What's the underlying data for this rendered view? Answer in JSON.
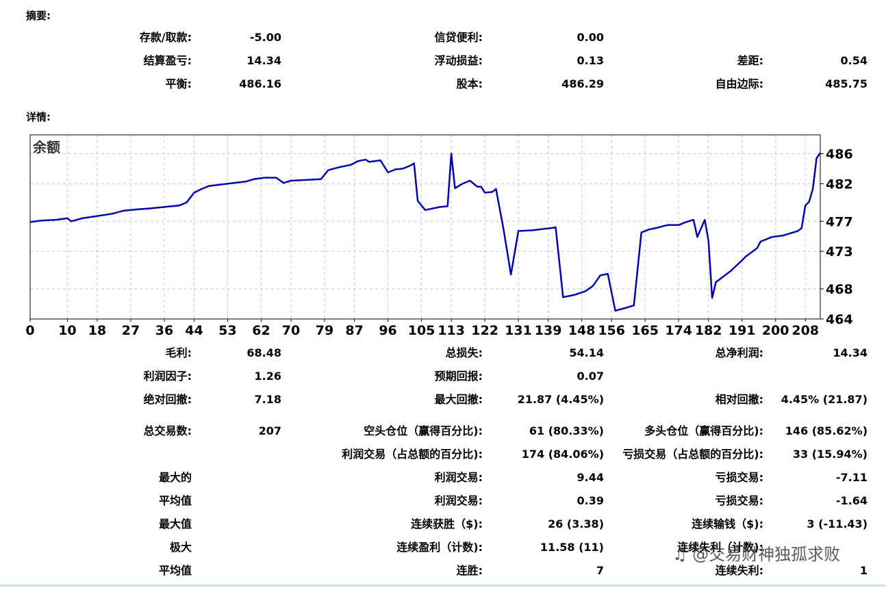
{
  "summary": {
    "title": "摘要:",
    "rows": [
      [
        {
          "label": "存款/取款:",
          "value": "-5.00"
        },
        {
          "label": "信贷便利:",
          "value": "0.00"
        },
        null
      ],
      [
        {
          "label": "结算盈亏:",
          "value": "14.34"
        },
        {
          "label": "浮动损益:",
          "value": "0.13"
        },
        {
          "label": "差距:",
          "value": "0.54"
        }
      ],
      [
        {
          "label": "平衡:",
          "value": "486.16"
        },
        {
          "label": "股本:",
          "value": "486.29"
        },
        {
          "label": "自由边际:",
          "value": "485.75"
        }
      ]
    ]
  },
  "details": {
    "title": "详情:"
  },
  "chart_data": {
    "type": "line",
    "title": "余额",
    "series": [
      {
        "name": "余额",
        "color": "#0000b4",
        "points": [
          [
            0,
            476.9
          ],
          [
            3,
            477.1
          ],
          [
            7,
            477.2
          ],
          [
            10,
            477.4
          ],
          [
            11,
            477.0
          ],
          [
            14,
            477.4
          ],
          [
            18,
            477.7
          ],
          [
            22,
            478.0
          ],
          [
            25,
            478.4
          ],
          [
            29,
            478.6
          ],
          [
            32,
            478.7
          ],
          [
            36,
            478.9
          ],
          [
            40,
            479.1
          ],
          [
            42,
            479.5
          ],
          [
            44,
            480.8
          ],
          [
            46,
            481.3
          ],
          [
            48,
            481.7
          ],
          [
            53,
            482.0
          ],
          [
            58,
            482.3
          ],
          [
            60,
            482.6
          ],
          [
            63,
            482.8
          ],
          [
            66,
            482.8
          ],
          [
            68,
            482.1
          ],
          [
            70,
            482.4
          ],
          [
            74,
            482.5
          ],
          [
            78,
            482.6
          ],
          [
            80,
            483.8
          ],
          [
            83,
            484.2
          ],
          [
            86,
            484.5
          ],
          [
            88,
            485.0
          ],
          [
            90,
            485.2
          ],
          [
            91,
            484.9
          ],
          [
            94,
            485.1
          ],
          [
            96,
            483.5
          ],
          [
            98,
            483.9
          ],
          [
            100,
            484.0
          ],
          [
            102,
            484.4
          ],
          [
            103,
            484.7
          ],
          [
            104,
            479.7
          ],
          [
            106,
            478.5
          ],
          [
            110,
            478.9
          ],
          [
            112,
            479.0
          ],
          [
            113,
            486.0
          ],
          [
            114,
            481.4
          ],
          [
            116,
            482.0
          ],
          [
            118,
            482.4
          ],
          [
            120,
            481.6
          ],
          [
            121,
            481.6
          ],
          [
            122,
            480.8
          ],
          [
            124,
            480.9
          ],
          [
            125,
            481.3
          ],
          [
            127,
            476.0
          ],
          [
            129,
            469.9
          ],
          [
            131,
            475.7
          ],
          [
            135,
            475.8
          ],
          [
            138,
            476.0
          ],
          [
            140,
            476.1
          ],
          [
            141,
            476.2
          ],
          [
            143,
            466.9
          ],
          [
            146,
            467.2
          ],
          [
            149,
            467.7
          ],
          [
            151,
            468.4
          ],
          [
            153,
            469.8
          ],
          [
            155,
            470.0
          ],
          [
            157,
            465.1
          ],
          [
            160,
            465.5
          ],
          [
            162,
            465.8
          ],
          [
            164,
            475.5
          ],
          [
            166,
            475.9
          ],
          [
            168,
            476.1
          ],
          [
            171,
            476.5
          ],
          [
            174,
            476.5
          ],
          [
            176,
            476.9
          ],
          [
            178,
            477.2
          ],
          [
            179,
            474.9
          ],
          [
            181,
            477.2
          ],
          [
            182,
            474.4
          ],
          [
            183,
            466.8
          ],
          [
            184,
            468.9
          ],
          [
            188,
            470.4
          ],
          [
            191,
            471.8
          ],
          [
            192,
            472.3
          ],
          [
            195,
            473.4
          ],
          [
            196,
            474.3
          ],
          [
            199,
            474.9
          ],
          [
            202,
            475.1
          ],
          [
            206,
            475.7
          ],
          [
            207,
            476.1
          ],
          [
            208,
            479.1
          ],
          [
            209,
            479.6
          ],
          [
            210,
            481.3
          ],
          [
            211,
            485.4
          ],
          [
            212,
            486.1
          ]
        ]
      }
    ],
    "x_ticks": [
      0,
      10,
      18,
      27,
      36,
      44,
      53,
      62,
      70,
      79,
      87,
      96,
      105,
      113,
      122,
      131,
      139,
      148,
      156,
      165,
      174,
      182,
      191,
      200,
      208
    ],
    "y_ticks": [
      464,
      468,
      473,
      477,
      482,
      486
    ],
    "xlim": [
      0,
      212
    ],
    "ylim": [
      464,
      488.5
    ],
    "grid": true,
    "legend": "none"
  },
  "stats": {
    "rows": [
      [
        {
          "label": "毛利:",
          "value": "68.48"
        },
        {
          "label": "总损失:",
          "value": "54.14"
        },
        {
          "label": "总净利润:",
          "value": "14.34"
        }
      ],
      [
        {
          "label": "利润因子:",
          "value": "1.26"
        },
        {
          "label": "预期回报:",
          "value": "0.07"
        },
        null
      ],
      [
        {
          "label": "绝对回撤:",
          "value": "7.18"
        },
        {
          "label": "最大回撤:",
          "value": "21.87 (4.45%)"
        },
        {
          "label": "相对回撤:",
          "value": "4.45% (21.87)"
        }
      ],
      [
        {
          "label": "总交易数:",
          "value": "207"
        },
        {
          "label": "空头仓位（赢得百分比):",
          "value": "61 (80.33%)"
        },
        {
          "label": "多头仓位（赢得百分比):",
          "value": "146 (85.62%)"
        }
      ],
      [
        null,
        {
          "label": "利润交易（占总额的百分比):",
          "value": "174 (84.06%)"
        },
        {
          "label": "亏损交易（占总额的百分比):",
          "value": "33 (15.94%)"
        }
      ],
      [
        {
          "label": "最大的",
          "value": ""
        },
        {
          "label": "利润交易:",
          "value": "9.44"
        },
        {
          "label": "亏损交易:",
          "value": "-7.11"
        }
      ],
      [
        {
          "label": "平均值",
          "value": ""
        },
        {
          "label": "利润交易:",
          "value": "0.39"
        },
        {
          "label": "亏损交易:",
          "value": "-1.64"
        }
      ],
      [
        {
          "label": "最大值",
          "value": ""
        },
        {
          "label": "连续获胜（$):",
          "value": "26 (3.38)"
        },
        {
          "label": "连续输钱（$):",
          "value": "3 (-11.43)"
        }
      ],
      [
        {
          "label": "极大",
          "value": ""
        },
        {
          "label": "连续盈利（计数):",
          "value": "11.58 (11)"
        },
        {
          "label": "连续失利（计数):",
          "value": ""
        }
      ],
      [
        {
          "label": "平均值",
          "value": ""
        },
        {
          "label": "连胜:",
          "value": "7"
        },
        {
          "label": "连续失利:",
          "value": "1"
        }
      ]
    ]
  },
  "watermark": "@交易财神独孤求败"
}
